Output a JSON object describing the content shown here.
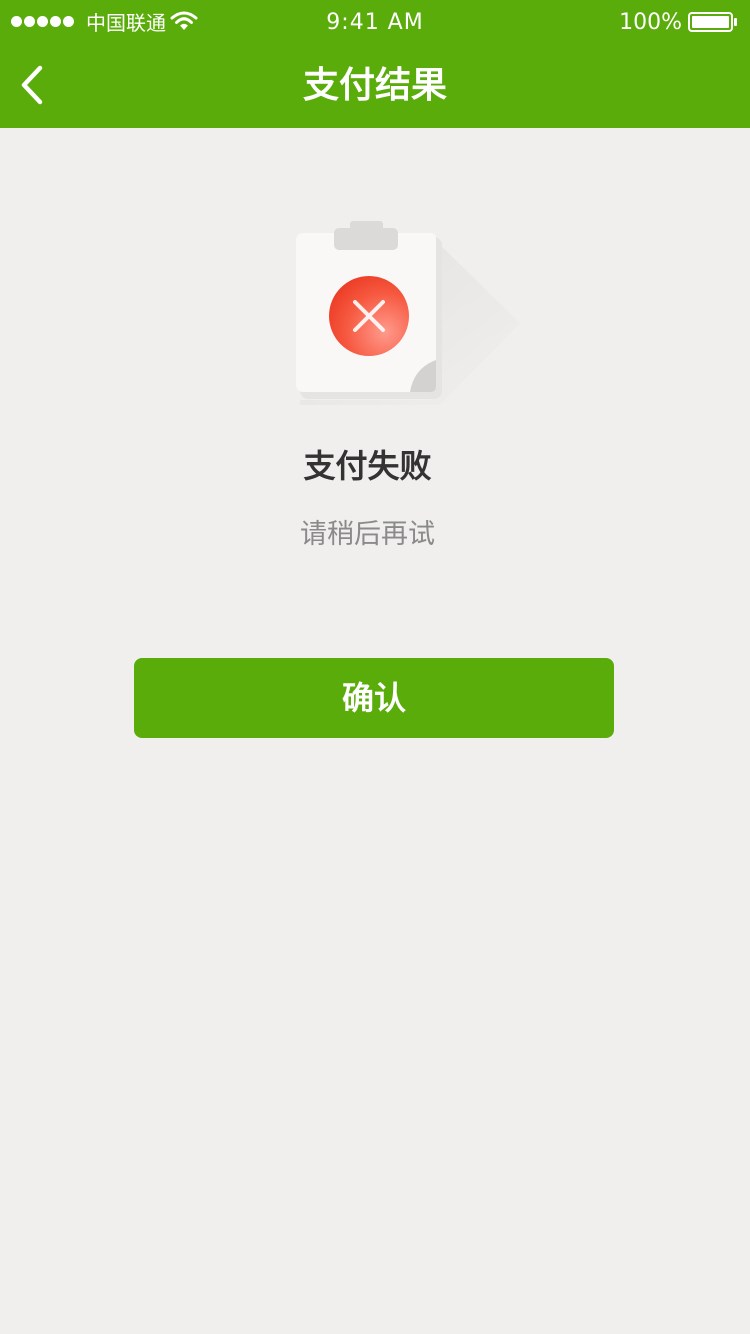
{
  "status_bar": {
    "carrier": "中国联通",
    "time": "9:41 AM",
    "battery": "100%",
    "icons": [
      "signal-dots-icon",
      "wifi-icon",
      "battery-icon"
    ]
  },
  "nav": {
    "back_icon": "chevron-left-icon",
    "title": "支付结果"
  },
  "result": {
    "icon": "payment-failed-clipboard-icon",
    "title": "支付失败",
    "subtitle": "请稍后再试"
  },
  "actions": {
    "confirm_label": "确认"
  },
  "colors": {
    "brand": "#5aac0a",
    "background": "#f0efed",
    "error": "#f5432a",
    "title_text": "#333333",
    "subtitle_text": "#8a8a8a"
  }
}
